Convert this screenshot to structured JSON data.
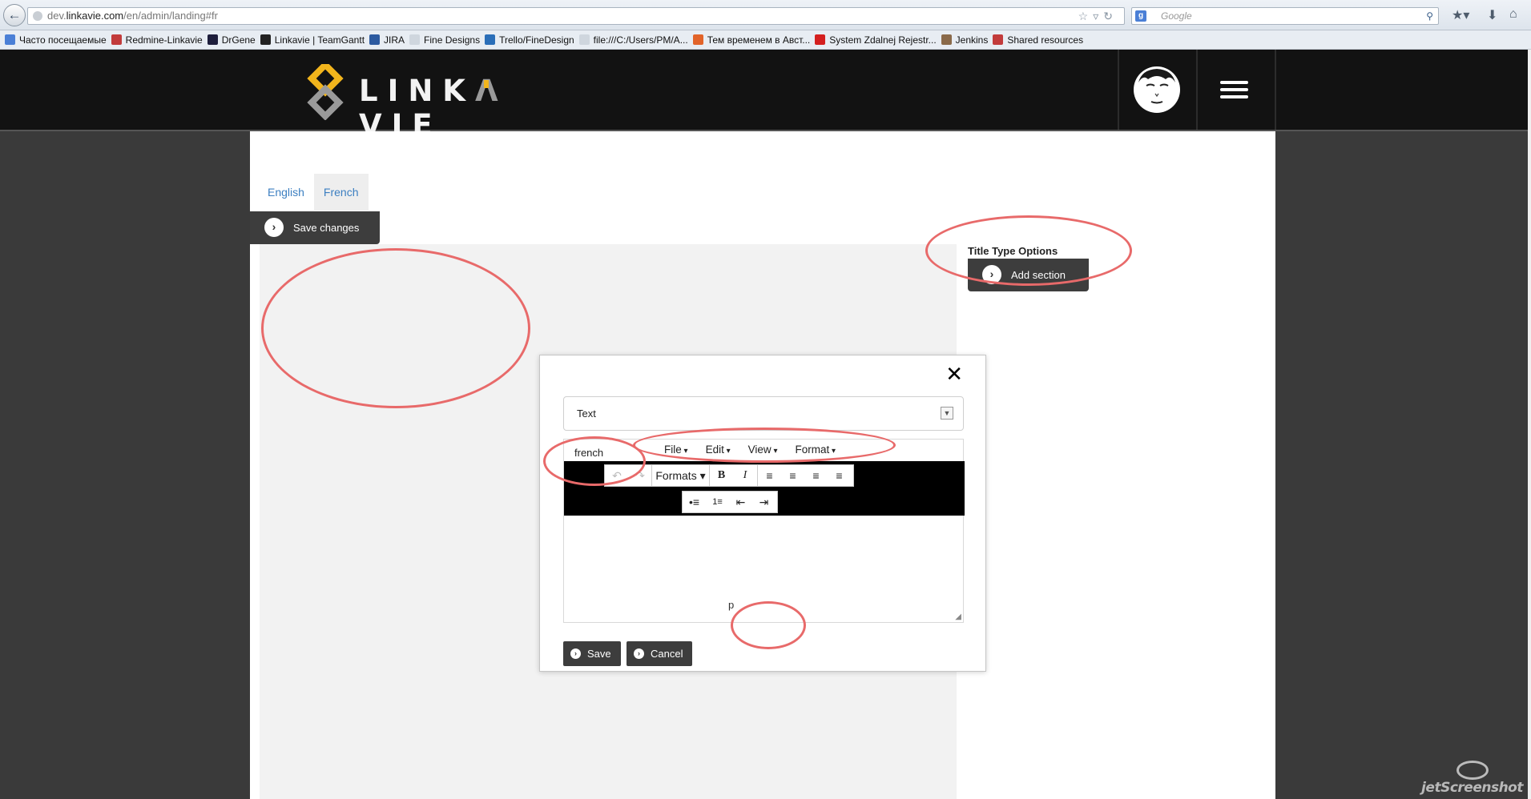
{
  "browser": {
    "url_prefix": "dev.",
    "url_domain": "linkavie.com",
    "url_path": "/en/admin/landing#fr",
    "search_engine_placeholder": "Google",
    "bookmarks": [
      {
        "label": "Часто посещаемые",
        "color": "#4a7fd6"
      },
      {
        "label": "Redmine-Linkavie",
        "color": "#c23b3b"
      },
      {
        "label": "DrGene",
        "color": "#1e1e3c"
      },
      {
        "label": "Linkavie | TeamGantt",
        "color": "#222222"
      },
      {
        "label": "JIRA",
        "color": "#2c5aa0"
      },
      {
        "label": "Fine Designs",
        "color": "#cfd6de"
      },
      {
        "label": "Trello/FineDesign",
        "color": "#2a6eb8"
      },
      {
        "label": "file:///C:/Users/PM/A...",
        "color": "#cfd6de"
      },
      {
        "label": "Тем временем в Авст...",
        "color": "#e2642a"
      },
      {
        "label": "System Zdalnej Rejestr...",
        "color": "#d41f1f"
      },
      {
        "label": "Jenkins",
        "color": "#8a6a4a"
      },
      {
        "label": "Shared resources",
        "color": "#c23b3b"
      }
    ]
  },
  "header": {
    "logo_text_left": "LINK",
    "logo_text_right": "VIE",
    "brand_colors": {
      "gold": "#f2b51c",
      "grey": "#9a9a9a",
      "bg": "#121212"
    }
  },
  "tabs": [
    {
      "label": "English",
      "active": false
    },
    {
      "label": "French",
      "active": true
    }
  ],
  "save_changes_label": "Save changes",
  "sidebar": {
    "title": "Title Type Options",
    "add_section_label": "Add section"
  },
  "modal": {
    "type_value": "Text",
    "field_label": "french",
    "menu": [
      "File",
      "Edit",
      "View",
      "Format"
    ],
    "formats_label": "Formats",
    "path_text": "p",
    "save_label": "Save",
    "cancel_label": "Cancel"
  },
  "watermark": "jetScreenshot"
}
